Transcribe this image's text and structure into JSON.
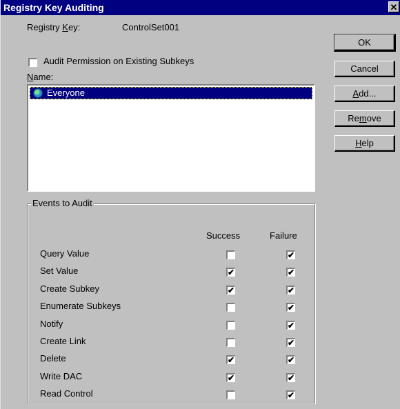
{
  "window": {
    "title": "Registry Key Auditing",
    "close_glyph": "✕"
  },
  "registry_key": {
    "label_pre": "Registry ",
    "label_u": "K",
    "label_post": "ey:",
    "value": "ControlSet001"
  },
  "audit_existing": {
    "label": "Audit Permission on Existing Subkeys",
    "checked": false
  },
  "name_label": {
    "u": "N",
    "rest": "ame:"
  },
  "names": [
    {
      "label": "Everyone",
      "icon": "globe-icon",
      "selected": true
    }
  ],
  "events": {
    "group_title": "Events to Audit",
    "columns": [
      "Success",
      "Failure"
    ],
    "rows": [
      {
        "label": "Query Value",
        "success": false,
        "failure": true
      },
      {
        "label": "Set Value",
        "success": true,
        "failure": true
      },
      {
        "label": "Create Subkey",
        "success": true,
        "failure": true
      },
      {
        "label": "Enumerate Subkeys",
        "success": false,
        "failure": true
      },
      {
        "label": "Notify",
        "success": false,
        "failure": true
      },
      {
        "label": "Create Link",
        "success": false,
        "failure": true
      },
      {
        "label": "Delete",
        "success": true,
        "failure": true
      },
      {
        "label": "Write DAC",
        "success": true,
        "failure": true
      },
      {
        "label": "Read Control",
        "success": false,
        "failure": true
      }
    ]
  },
  "buttons": {
    "ok": "OK",
    "cancel": "Cancel",
    "add": {
      "u": "A",
      "rest": "dd..."
    },
    "remove": {
      "pre": "Re",
      "u": "m",
      "rest": "ove"
    },
    "help": {
      "u": "H",
      "rest": "elp"
    }
  },
  "check_glyph": "✔"
}
